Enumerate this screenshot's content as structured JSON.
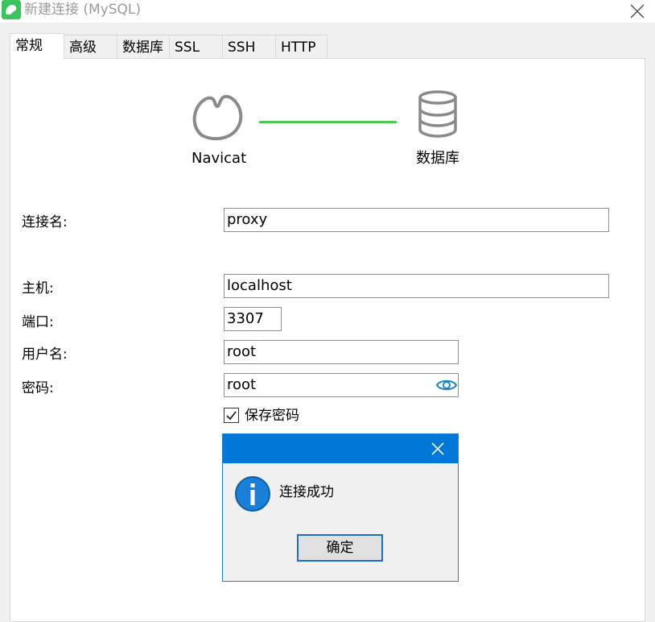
{
  "window": {
    "title": "新建连接 (MySQL)",
    "app_icon": "navicat-icon",
    "close_icon": "close-icon"
  },
  "tabs": [
    {
      "label": "常规",
      "active": true
    },
    {
      "label": "高级",
      "active": false
    },
    {
      "label": "数据库",
      "active": false
    },
    {
      "label": "SSL",
      "active": false
    },
    {
      "label": "SSH",
      "active": false
    },
    {
      "label": "HTTP",
      "active": false
    }
  ],
  "diagram": {
    "left_label": "Navicat",
    "right_label": "数据库",
    "line_color": "#4cc752"
  },
  "form": {
    "connection_name_label": "连接名:",
    "connection_name_value": "proxy",
    "host_label": "主机:",
    "host_value": "localhost",
    "port_label": "端口:",
    "port_value": "3307",
    "username_label": "用户名:",
    "username_value": "root",
    "password_label": "密码:",
    "password_value": "root",
    "save_password_label": "保存密码",
    "save_password_checked": true
  },
  "dialog": {
    "message": "连接成功",
    "ok_label": "确定",
    "titlebar_color": "#0078d7",
    "icon": "info-icon"
  }
}
